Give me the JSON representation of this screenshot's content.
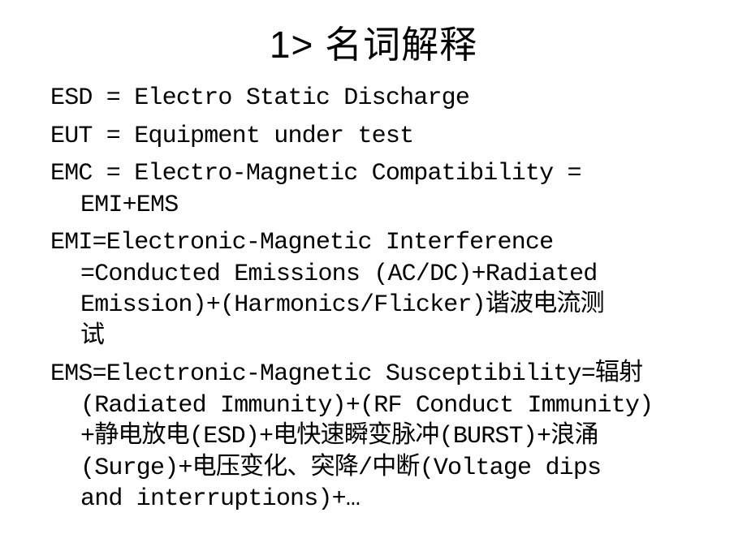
{
  "slide": {
    "title": "1> 名词解释",
    "definitions": [
      {
        "term": "ESD",
        "lines": [
          "ESD = Electro Static Discharge"
        ]
      },
      {
        "term": "EUT",
        "lines": [
          "EUT = Equipment under test"
        ]
      },
      {
        "term": "EMC",
        "lines": [
          "EMC = Electro-Magnetic Compatibility =",
          "EMI+EMS"
        ]
      },
      {
        "term": "EMI",
        "lines": [
          "EMI=Electronic-Magnetic Interference",
          "=Conducted Emissions (AC/DC)+Radiated",
          "Emission)+(Harmonics/Flicker)谐波电流测",
          "试"
        ]
      },
      {
        "term": "EMS",
        "lines": [
          "EMS=Electronic-Magnetic Susceptibility=辐射",
          "(Radiated Immunity)+(RF Conduct Immunity)",
          "+静电放电(ESD)+电快速瞬变脉冲(BURST)+浪涌",
          "(Surge)+电压变化、突降/中断(Voltage dips",
          "and interruptions)+…"
        ]
      }
    ]
  }
}
